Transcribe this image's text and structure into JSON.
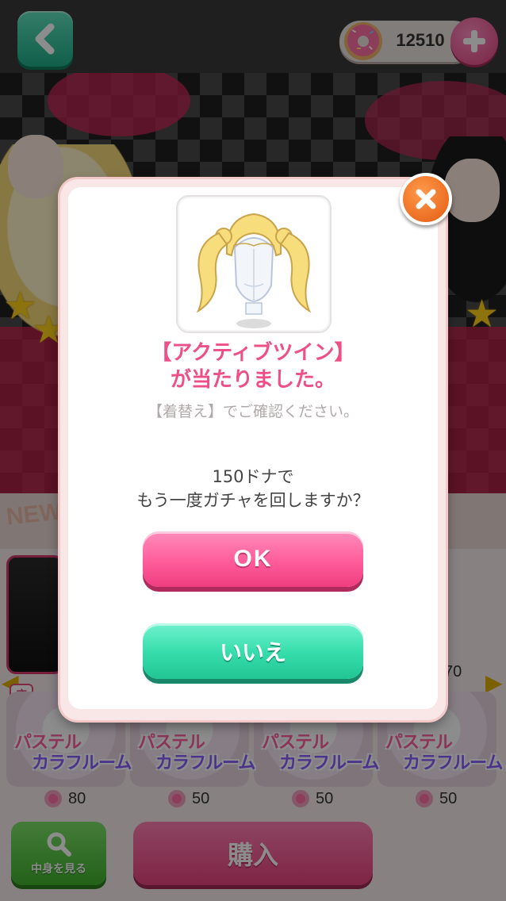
{
  "header": {
    "coin_value": "12510"
  },
  "dialog": {
    "item_name_line1": "【アクティブツイン】",
    "item_name_line2": "が当たりました。",
    "hint": "【着替え】でご確認ください。",
    "question_line1": "150ドナで",
    "question_line2": "もう一度ガチャを回しますか？",
    "ok_label": "OK",
    "no_label": "いいえ",
    "item_icon": "twin-tail-hair-icon"
  },
  "shop": {
    "floor_tag": "床",
    "items": [
      {
        "line1": "パステル",
        "line2": "カラフルーム",
        "price": "80"
      },
      {
        "line1": "パステル",
        "line2": "カラフルーム",
        "price": "50"
      },
      {
        "line1": "パステル",
        "line2": "カラフルーム",
        "price": "50"
      },
      {
        "line1": "パステル",
        "line2": "カラフルーム",
        "price": "50"
      }
    ],
    "partial_price": "70",
    "view_label": "中身を見る",
    "buy_label": "購入"
  },
  "colors": {
    "ok": "#ff5c9a",
    "no": "#34dcaa",
    "item_name": "#ee4f86",
    "close": "#e35a12"
  }
}
